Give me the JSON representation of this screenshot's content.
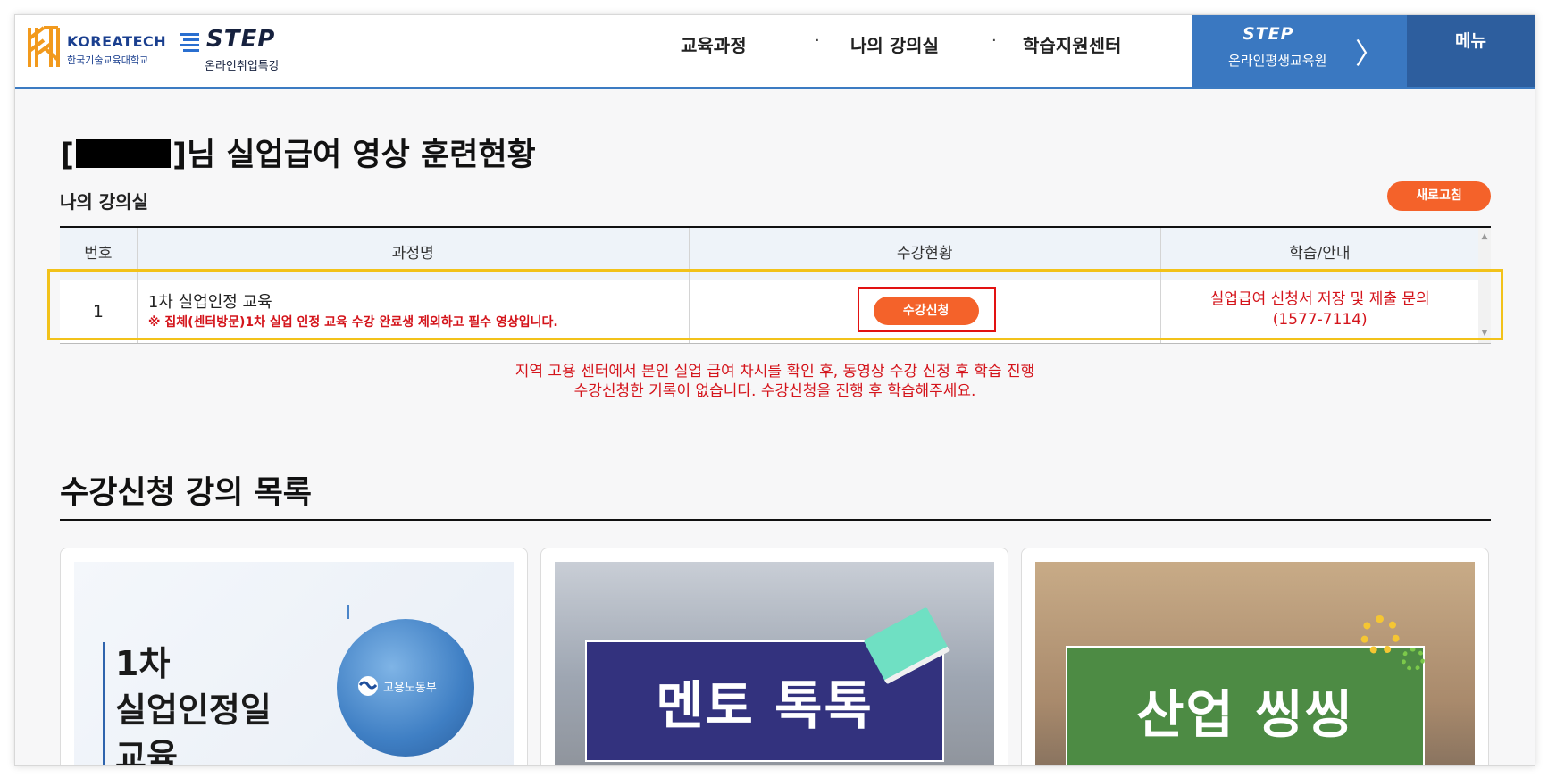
{
  "header": {
    "kt_name": "KOREATECH",
    "kt_sub": "한국기술교육대학교",
    "step_word": "STEP",
    "step_sub": "온라인취업특강",
    "nav": [
      "교육과정",
      "나의 강의실",
      "학습지원센터"
    ],
    "nav_sep": "·",
    "step_box_logo": "STEP",
    "step_box_sub": "온라인평생교육원",
    "step_box_arrow": "〉",
    "menu": "메뉴"
  },
  "page": {
    "title_open": "[",
    "title_rest": "]님 실업급여 영상 훈련현황",
    "section_label": "나의 강의실",
    "refresh_label": "새로고침"
  },
  "table": {
    "headers": [
      "번호",
      "과정명",
      "수강현황",
      "학습/안내"
    ],
    "rows": [
      {
        "num": "1",
        "course_name": "1차 실업인정 교육",
        "course_note": "※ 집체(센터방문)1차 실업 인정 교육 수강 완료생 제외하고 필수 영상입니다.",
        "enroll_label": "수강신청",
        "guide_line1": "실업급여 신청서 저장 및 제출 문의",
        "guide_line2": "(1577-7114)"
      }
    ]
  },
  "notice": {
    "line1": "지역 고용 센터에서 본인 실업 급여 차시를 확인 후, 동영상 수강 신청 후 학습 진행",
    "line2": "수강신청한 기록이 없습니다. 수강신청을 진행 후 학습해주세요."
  },
  "list": {
    "title": "수강신청 강의 목록",
    "cards": [
      {
        "text_lines": [
          "1차",
          "실업인정일",
          "교육"
        ],
        "badge": "고용노동부"
      },
      {
        "text": "멘토 톡톡"
      },
      {
        "text": "산업 씽씽"
      }
    ]
  },
  "colors": {
    "accent_blue": "#3a78c1",
    "menu_blue": "#2d5e9e",
    "orange_button": "#f4622a",
    "red_text": "#d4141b",
    "highlight_yellow": "#f2c21a"
  }
}
